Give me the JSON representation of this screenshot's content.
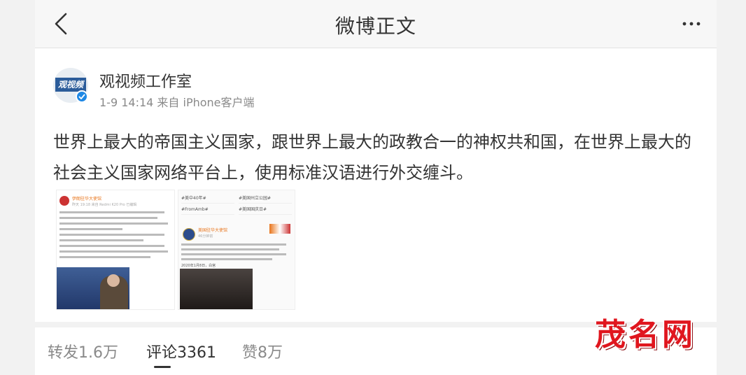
{
  "navbar": {
    "title": "微博正文",
    "back_icon": "chevron-left-icon",
    "more_icon": "ellipsis-icon"
  },
  "post": {
    "author": "观视频工作室",
    "avatar_logo_text": "观视频",
    "verified": true,
    "meta": "1-9 14:14 来自 iPhone客户端",
    "text": "世界上最大的帝国主义国家，跟世界上最大的政教合一的神权共和国，在世界上最大的社会主义国家网络平台上，使用标准汉语进行外交缠斗。",
    "images": [
      {
        "account": "伊朗驻华大使馆",
        "meta": "昨天 19:18 来自 Redmi K20 Pro 已编辑"
      },
      {
        "tags": [
          "#美中40年#",
          "#美国州立公园#",
          "#FromAmb#",
          "#美国国庆日#"
        ],
        "account": "美国驻华大使馆",
        "meta": "46分钟前",
        "quote_date": "2020年1月8日，白宫"
      }
    ]
  },
  "tabs": [
    {
      "label": "转发1.6万",
      "active": false
    },
    {
      "label": "评论3361",
      "active": true
    },
    {
      "label": "赞8万",
      "active": false
    }
  ],
  "watermark": "茂名网",
  "colors": {
    "accent": "#e8741a",
    "verified": "#1e88e5",
    "watermark": "#e0161e"
  }
}
